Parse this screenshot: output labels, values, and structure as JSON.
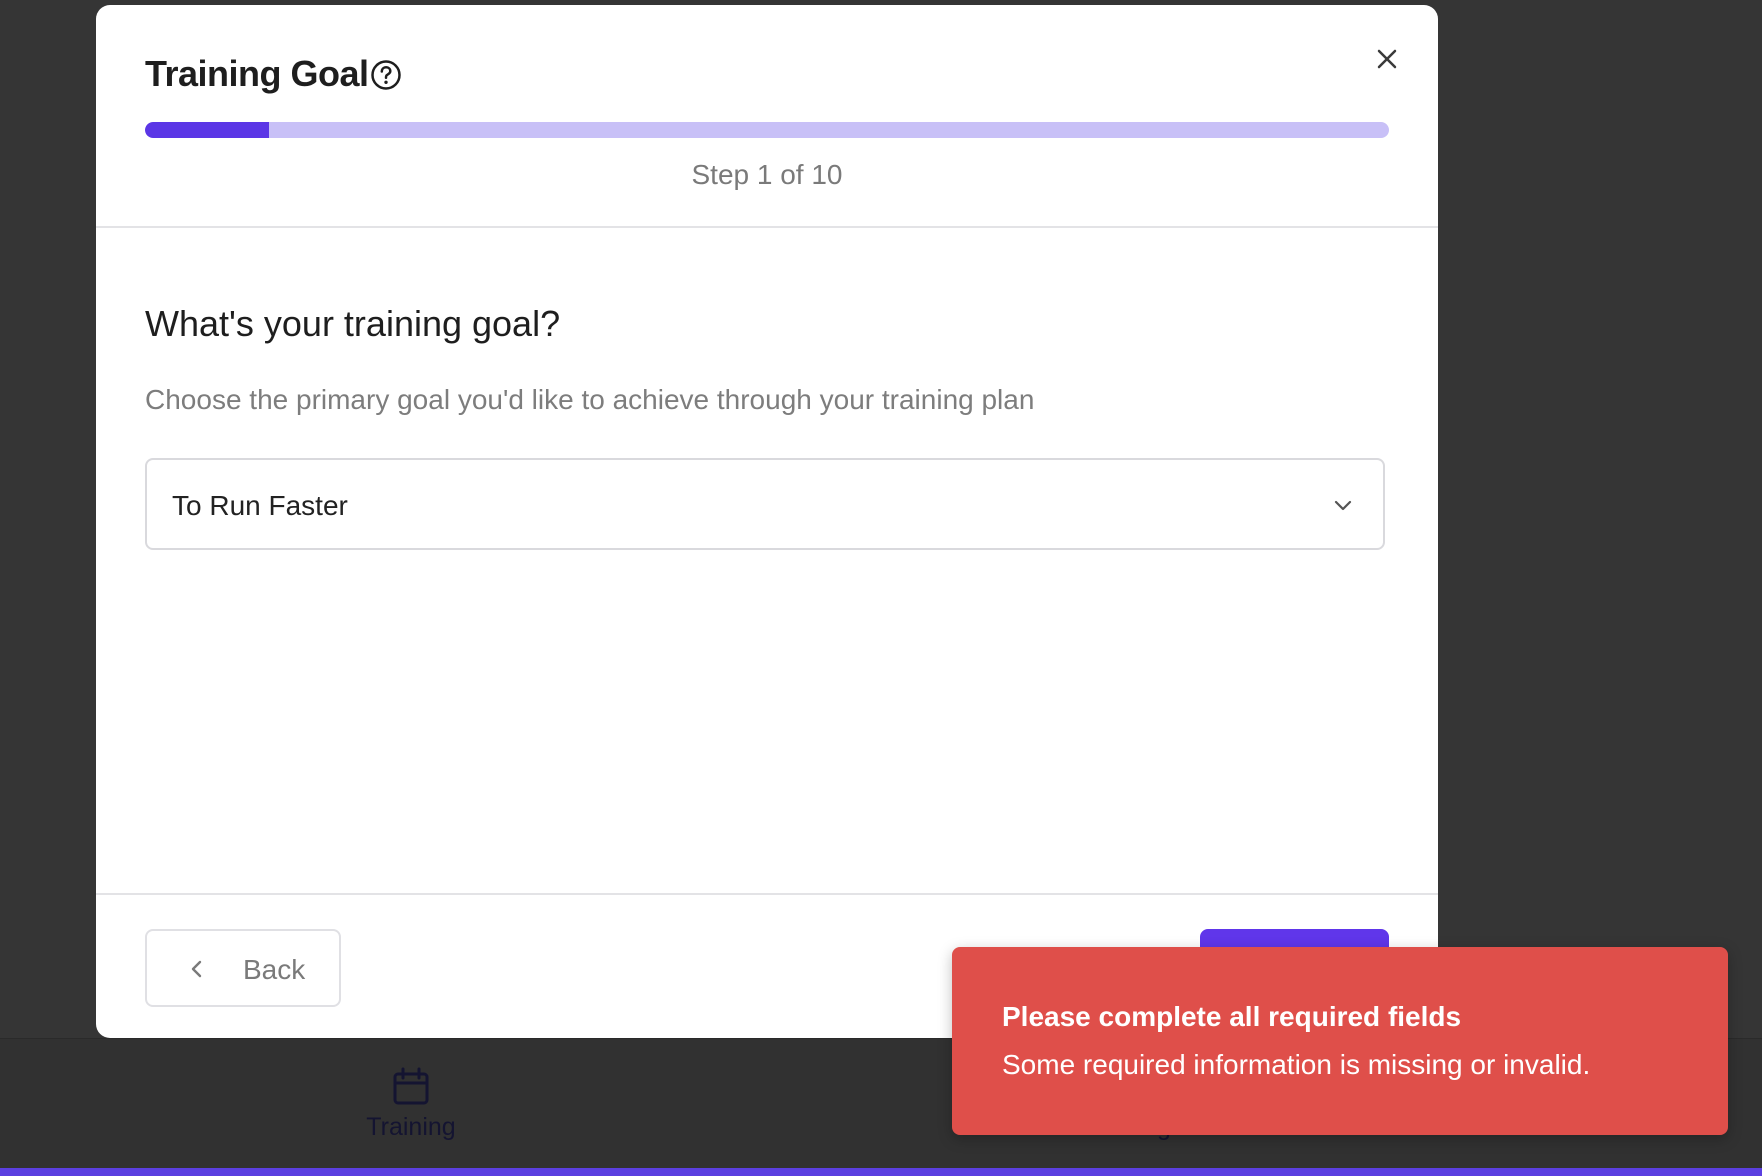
{
  "modal": {
    "title": "Training Goal",
    "progress": {
      "current_step": 1,
      "total_steps": 10,
      "fraction": 0.1
    },
    "step_text": "Step 1 of 10",
    "question": "What's your training goal?",
    "subtext": "Choose the primary goal you'd like to achieve through your training plan",
    "goal_select": {
      "selected": "To Run Faster"
    },
    "back_label": "Back"
  },
  "bottom_nav": {
    "items": [
      {
        "label": "Training",
        "icon": "calendar-icon"
      },
      {
        "label": "Log"
      }
    ]
  },
  "toast": {
    "title": "Please complete all required fields",
    "message": "Some required information is missing or invalid."
  },
  "colors": {
    "accent": "#5b36e6",
    "progress_track": "#c8c0f7",
    "toast_bg": "#df4f4a",
    "overlay": "#353535"
  }
}
